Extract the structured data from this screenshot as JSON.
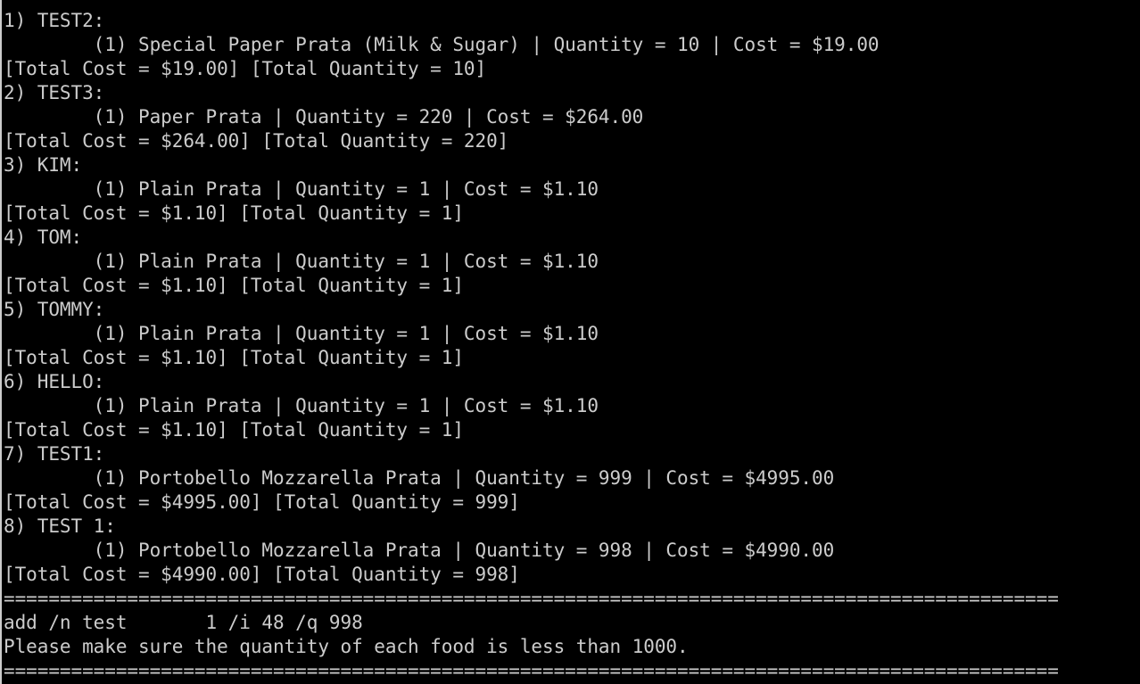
{
  "terminal": {
    "lines": [
      "--------------------------------------------------------------------------",
      "1) TEST2:",
      "\t(1) Special Paper Prata (Milk & Sugar) | Quantity = 10 | Cost = $19.00",
      "[Total Cost = $19.00] [Total Quantity = 10]",
      "2) TEST3:",
      "\t(1) Paper Prata | Quantity = 220 | Cost = $264.00",
      "[Total Cost = $264.00] [Total Quantity = 220]",
      "3) KIM:",
      "\t(1) Plain Prata | Quantity = 1 | Cost = $1.10",
      "[Total Cost = $1.10] [Total Quantity = 1]",
      "4) TOM:",
      "\t(1) Plain Prata | Quantity = 1 | Cost = $1.10",
      "[Total Cost = $1.10] [Total Quantity = 1]",
      "5) TOMMY:",
      "\t(1) Plain Prata | Quantity = 1 | Cost = $1.10",
      "[Total Cost = $1.10] [Total Quantity = 1]",
      "6) HELLO:",
      "\t(1) Plain Prata | Quantity = 1 | Cost = $1.10",
      "[Total Cost = $1.10] [Total Quantity = 1]",
      "7) TEST1:",
      "\t(1) Portobello Mozzarella Prata | Quantity = 999 | Cost = $4995.00",
      "[Total Cost = $4995.00] [Total Quantity = 999]",
      "8) TEST 1:",
      "\t(1) Portobello Mozzarella Prata | Quantity = 998 | Cost = $4990.00",
      "[Total Cost = $4990.00] [Total Quantity = 998]",
      "==============================================================================================",
      "add /n test       1 /i 48 /q 998",
      "Please make sure the quantity of each food is less than 1000.",
      "=============================================================================================="
    ]
  },
  "colors": {
    "background": "#000000",
    "text": "#cccccc"
  }
}
